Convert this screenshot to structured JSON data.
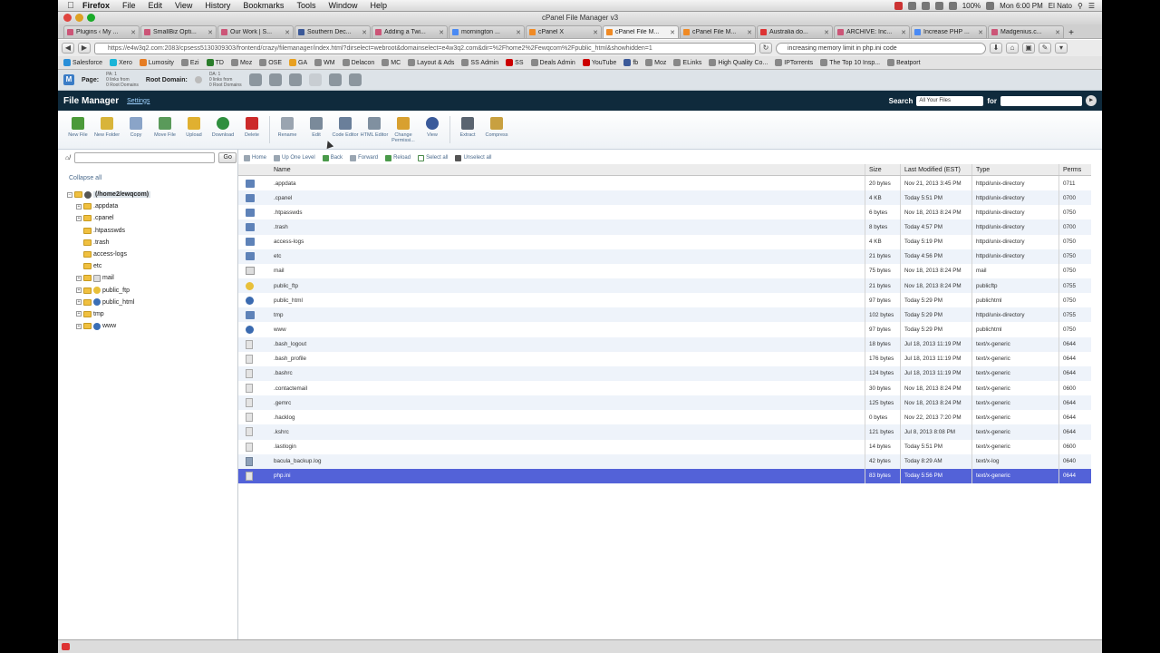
{
  "menubar": {
    "app": "Firefox",
    "items": [
      "File",
      "Edit",
      "View",
      "History",
      "Bookmarks",
      "Tools",
      "Window",
      "Help"
    ],
    "battery": "100%",
    "clock": "Mon 6:00 PM",
    "user": "El Nato"
  },
  "window_title": "cPanel File Manager v3",
  "tabs": [
    {
      "label": "Plugins ‹ My ..."
    },
    {
      "label": "SmallBiz Opti..."
    },
    {
      "label": "Our Work | S..."
    },
    {
      "label": "Southern Dec..."
    },
    {
      "label": "Adding a Twi..."
    },
    {
      "label": "mornington ..."
    },
    {
      "label": "cPanel X"
    },
    {
      "label": "cPanel File M...",
      "active": true
    },
    {
      "label": "cPanel File M..."
    },
    {
      "label": "Australia do..."
    },
    {
      "label": "ARCHIVE: Inc..."
    },
    {
      "label": "Increase PHP ..."
    },
    {
      "label": "Madgenius.c..."
    }
  ],
  "url": "https://e4w3q2.com:2083/cpsess5130309303/frontend/crazy/filemanager/index.html?dirselect=webroot&domainselect=e4w3q2.com&dir=%2Fhome2%2Fewqcom%2Fpublic_html&showhidden=1",
  "search_query": "increasing memory limit in php.ini code",
  "bookmarks": [
    "Salesforce",
    "Xero",
    "Lumosity",
    "Ezi",
    "TD",
    "Moz",
    "OSE",
    "GA",
    "WM",
    "Delacon",
    "MC",
    "Layout & Ads",
    "SS Admin",
    "SS",
    "Deals Admin",
    "YouTube",
    "fb",
    "Moz",
    "ELinks",
    "High Quality Co...",
    "IPTorrents",
    "The Top 10 Insp...",
    "Beatport"
  ],
  "cpanel_top": {
    "page_label": "Page:",
    "page_stats_1": "PA: 1",
    "page_stats_2": "0 links from",
    "page_stats_3": "0 Root Domains",
    "root_label": "Root Domain:",
    "root_stats_1": "DA: 1",
    "root_stats_2": "0 links from",
    "root_stats_3": "0 Root Domains"
  },
  "file_manager": {
    "title": "File Manager",
    "settings": "Settings",
    "search_label": "Search",
    "search_scope": "All Your Files",
    "for_label": "for"
  },
  "toolbar": [
    {
      "label": "New File",
      "color": "#4c9a3a"
    },
    {
      "label": "New Folder",
      "color": "#d8b43a"
    },
    {
      "label": "Copy",
      "color": "#8aa4c8"
    },
    {
      "label": "Move File",
      "color": "#5a9a5a"
    },
    {
      "label": "Upload",
      "color": "#e0b030"
    },
    {
      "label": "Download",
      "color": "#2f8f3f"
    },
    {
      "label": "Delete",
      "color": "#cc2a2a"
    },
    {
      "label": "Rename",
      "color": "#9aa4b0"
    },
    {
      "label": "Edit",
      "color": "#7a8a9a"
    },
    {
      "label": "Code Editor",
      "color": "#6a7f9a"
    },
    {
      "label": "HTML Editor",
      "color": "#8090a0"
    },
    {
      "label": "Change Permissi...",
      "color": "#d8a030"
    },
    {
      "label": "View",
      "color": "#3a5a9a"
    },
    {
      "label": "Extract",
      "color": "#5a6470"
    },
    {
      "label": "Compress",
      "color": "#c8a040"
    }
  ],
  "left_panel": {
    "go_label": "Go",
    "collapse_all": "Collapse all",
    "root": "(/home2/ewqcom)",
    "tree": [
      ".appdata",
      ".cpanel",
      ".htpasswds",
      ".trash",
      "access-logs",
      "etc",
      "mail",
      "public_ftp",
      "public_html",
      "tmp",
      "www"
    ]
  },
  "pathbar": [
    "Home",
    "Up One Level",
    "Back",
    "Forward",
    "Reload",
    "Select all",
    "Unselect all"
  ],
  "columns": {
    "name": "Name",
    "size": "Size",
    "modified": "Last Modified (EST)",
    "type": "Type",
    "perms": "Perms"
  },
  "files": [
    {
      "icon": "folder",
      "name": ".appdata",
      "size": "20 bytes",
      "modified": "Nov 21, 2013 3:45 PM",
      "type": "httpd/unix-directory",
      "perms": "0711"
    },
    {
      "icon": "folder",
      "name": ".cpanel",
      "size": "4 KB",
      "modified": "Today 5:51 PM",
      "type": "httpd/unix-directory",
      "perms": "0700"
    },
    {
      "icon": "folder",
      "name": ".htpasswds",
      "size": "6 bytes",
      "modified": "Nov 18, 2013 8:24 PM",
      "type": "httpd/unix-directory",
      "perms": "0750"
    },
    {
      "icon": "folder",
      "name": ".trash",
      "size": "8 bytes",
      "modified": "Today 4:57 PM",
      "type": "httpd/unix-directory",
      "perms": "0700"
    },
    {
      "icon": "folder",
      "name": "access-logs",
      "size": "4 KB",
      "modified": "Today 5:19 PM",
      "type": "httpd/unix-directory",
      "perms": "0750"
    },
    {
      "icon": "folder",
      "name": "etc",
      "size": "21 bytes",
      "modified": "Today 4:56 PM",
      "type": "httpd/unix-directory",
      "perms": "0750"
    },
    {
      "icon": "mail",
      "name": "mail",
      "size": "75 bytes",
      "modified": "Nov 18, 2013 8:24 PM",
      "type": "mail",
      "perms": "0750"
    },
    {
      "icon": "ftp",
      "name": "public_ftp",
      "size": "21 bytes",
      "modified": "Nov 18, 2013 8:24 PM",
      "type": "publicftp",
      "perms": "0755"
    },
    {
      "icon": "globe",
      "name": "public_html",
      "size": "97 bytes",
      "modified": "Today 5:29 PM",
      "type": "publichtml",
      "perms": "0750"
    },
    {
      "icon": "folder",
      "name": "tmp",
      "size": "102 bytes",
      "modified": "Today 5:29 PM",
      "type": "httpd/unix-directory",
      "perms": "0755"
    },
    {
      "icon": "globe",
      "name": "www",
      "size": "97 bytes",
      "modified": "Today 5:29 PM",
      "type": "publichtml",
      "perms": "0750"
    },
    {
      "icon": "file",
      "name": ".bash_logout",
      "size": "18 bytes",
      "modified": "Jul 18, 2013 11:19 PM",
      "type": "text/x-generic",
      "perms": "0644"
    },
    {
      "icon": "file",
      "name": ".bash_profile",
      "size": "176 bytes",
      "modified": "Jul 18, 2013 11:19 PM",
      "type": "text/x-generic",
      "perms": "0644"
    },
    {
      "icon": "file",
      "name": ".bashrc",
      "size": "124 bytes",
      "modified": "Jul 18, 2013 11:19 PM",
      "type": "text/x-generic",
      "perms": "0644"
    },
    {
      "icon": "file",
      "name": ".contactemail",
      "size": "30 bytes",
      "modified": "Nov 18, 2013 8:24 PM",
      "type": "text/x-generic",
      "perms": "0600"
    },
    {
      "icon": "file",
      "name": ".gemrc",
      "size": "125 bytes",
      "modified": "Nov 18, 2013 8:24 PM",
      "type": "text/x-generic",
      "perms": "0644"
    },
    {
      "icon": "file",
      "name": ".hacklog",
      "size": "0 bytes",
      "modified": "Nov 22, 2013 7:20 PM",
      "type": "text/x-generic",
      "perms": "0644"
    },
    {
      "icon": "file",
      "name": ".kshrc",
      "size": "121 bytes",
      "modified": "Jul 8, 2013 8:08 PM",
      "type": "text/x-generic",
      "perms": "0644"
    },
    {
      "icon": "file",
      "name": ".lastlogin",
      "size": "14 bytes",
      "modified": "Today 5:51 PM",
      "type": "text/x-generic",
      "perms": "0600"
    },
    {
      "icon": "log",
      "name": "bacula_backup.log",
      "size": "42 bytes",
      "modified": "Today 8:29 AM",
      "type": "text/x-log",
      "perms": "0640"
    },
    {
      "icon": "file",
      "name": "php.ini",
      "size": "83 bytes",
      "modified": "Today 5:56 PM",
      "type": "text/x-generic",
      "perms": "0644",
      "selected": true
    }
  ]
}
